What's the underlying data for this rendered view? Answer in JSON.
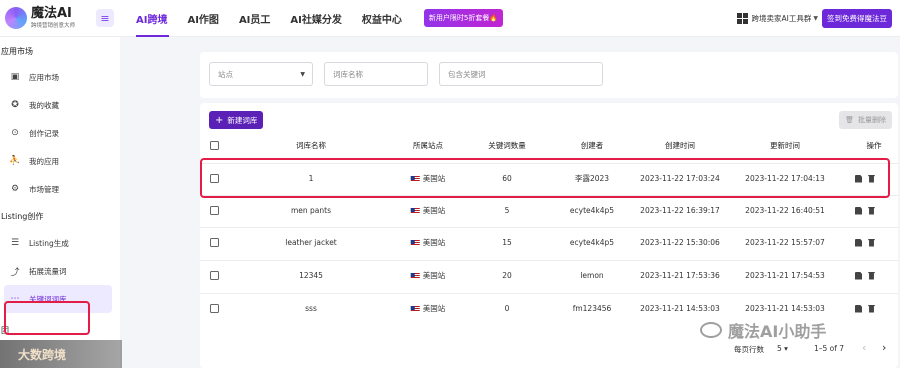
{
  "header": {
    "logo_name": "魔法AI",
    "logo_subtitle": "跨境营销创意大师",
    "nav": [
      "AI跨境",
      "AI作图",
      "AI员工",
      "AI社媒分发",
      "权益中心"
    ],
    "promo": "新用户限时5折套餐🔥",
    "group_link": "跨境卖家AI工具群",
    "signin_button": "签到免费得魔法豆"
  },
  "sidebar": {
    "section1": "应用市场",
    "items1": [
      {
        "icon": "store-icon",
        "label": "应用市场"
      },
      {
        "icon": "star-icon",
        "label": "我的收藏"
      },
      {
        "icon": "tape-icon",
        "label": "创作记录"
      },
      {
        "icon": "person-icon",
        "label": "我的应用"
      },
      {
        "icon": "manage-icon",
        "label": "市场管理"
      }
    ],
    "section2": "Listing创作",
    "items2": [
      {
        "icon": "list-icon",
        "label": "Listing生成"
      },
      {
        "icon": "trend-icon",
        "label": "拓展流量词"
      },
      {
        "icon": "keyword-icon",
        "label": "关键词词库"
      }
    ],
    "bottom_partial": "团",
    "watermark": "大数跨境"
  },
  "filters": {
    "site_placeholder": "站点",
    "name_placeholder": "词库名称",
    "keyword_placeholder": "包含关键词"
  },
  "table": {
    "new_button": "新建词库",
    "bulk_delete": "批量删除",
    "columns": [
      "词库名称",
      "所属站点",
      "关键词数量",
      "创建者",
      "创建时间",
      "更新时间",
      "操作"
    ],
    "rows": [
      {
        "name": "1",
        "site": "美国站",
        "count": "60",
        "creator": "李露2023",
        "created": "2023-11-22 17:03:24",
        "updated": "2023-11-22 17:04:13"
      },
      {
        "name": "men pants",
        "site": "美国站",
        "count": "5",
        "creator": "ecyte4k4p5",
        "created": "2023-11-22 16:39:17",
        "updated": "2023-11-22 16:40:51"
      },
      {
        "name": "leather jacket",
        "site": "美国站",
        "count": "15",
        "creator": "ecyte4k4p5",
        "created": "2023-11-22 15:30:06",
        "updated": "2023-11-22 15:57:07"
      },
      {
        "name": "12345",
        "site": "美国站",
        "count": "20",
        "creator": "lemon",
        "created": "2023-11-21 17:53:36",
        "updated": "2023-11-21 17:54:53"
      },
      {
        "name": "sss",
        "site": "美国站",
        "count": "0",
        "creator": "fm123456",
        "created": "2023-11-21 14:53:03",
        "updated": "2023-11-21 14:53:03"
      }
    ]
  },
  "pagination": {
    "rows_per_page_label": "每页行数",
    "rows_per_page": "5",
    "range": "1–5 of 7"
  },
  "watermark_right": "魔法AI小助手",
  "colors": {
    "accent": "#6d28d9",
    "highlight": "#e11d48"
  }
}
